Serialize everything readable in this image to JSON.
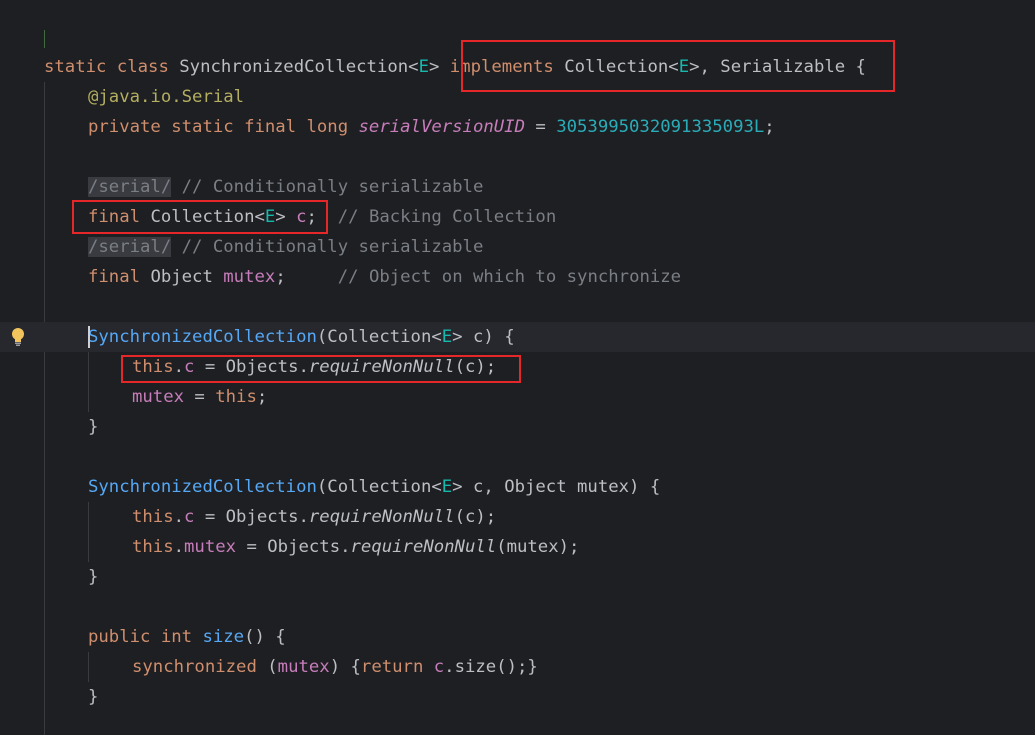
{
  "code_lines": [
    {
      "tokens": []
    },
    {
      "tokens": [
        {
          "t": "static class ",
          "k": "kw"
        },
        {
          "t": "SynchronizedCollection<",
          "k": "txt"
        },
        {
          "t": "E",
          "k": "tp"
        },
        {
          "t": "> ",
          "k": "txt"
        },
        {
          "t": "implements ",
          "k": "kw"
        },
        {
          "t": "Collection<",
          "k": "txt"
        },
        {
          "t": "E",
          "k": "tp"
        },
        {
          "t": ">, Serializable {",
          "k": "txt"
        }
      ]
    },
    {
      "tokens": [
        {
          "t": "@java.io.",
          "k": "ann"
        },
        {
          "t": "Serial",
          "k": "ann"
        }
      ]
    },
    {
      "tokens": [
        {
          "t": "private static final long ",
          "k": "kw"
        },
        {
          "t": "serialVersionUID",
          "k": "fldi"
        },
        {
          "t": " = ",
          "k": "txt"
        },
        {
          "t": "3053995032091335093L",
          "k": "num"
        },
        {
          "t": ";",
          "k": "txt"
        }
      ]
    },
    {
      "tokens": []
    },
    {
      "tokens": [
        {
          "t": "/serial/",
          "k": "tag"
        },
        {
          "t": " // Conditionally serializable",
          "k": "cmt"
        }
      ]
    },
    {
      "tokens": [
        {
          "t": "final ",
          "k": "kw"
        },
        {
          "t": "Collection<",
          "k": "txt"
        },
        {
          "t": "E",
          "k": "tp"
        },
        {
          "t": "> ",
          "k": "txt"
        },
        {
          "t": "c",
          "k": "fld"
        },
        {
          "t": ";  ",
          "k": "txt"
        },
        {
          "t": "// Backing Collection",
          "k": "cmt"
        }
      ]
    },
    {
      "tokens": [
        {
          "t": "/serial/",
          "k": "tag"
        },
        {
          "t": " // Conditionally serializable",
          "k": "cmt"
        }
      ]
    },
    {
      "tokens": [
        {
          "t": "final ",
          "k": "kw"
        },
        {
          "t": "Object ",
          "k": "txt"
        },
        {
          "t": "mutex",
          "k": "fld"
        },
        {
          "t": ";     ",
          "k": "txt"
        },
        {
          "t": "// Object on which to synchronize",
          "k": "cmt"
        }
      ]
    },
    {
      "tokens": []
    },
    {
      "tokens": [
        {
          "t": "SynchronizedCollection",
          "k": "fn"
        },
        {
          "t": "(Collection<",
          "k": "txt"
        },
        {
          "t": "E",
          "k": "tp"
        },
        {
          "t": "> c) {",
          "k": "txt"
        }
      ]
    },
    {
      "tokens": [
        {
          "t": "this",
          "k": "kw"
        },
        {
          "t": ".",
          "k": "txt"
        },
        {
          "t": "c",
          "k": "fld"
        },
        {
          "t": " = Objects.",
          "k": "txt"
        },
        {
          "t": "requireNonNull",
          "k": "it"
        },
        {
          "t": "(c);",
          "k": "txt"
        }
      ]
    },
    {
      "tokens": [
        {
          "t": "mutex",
          "k": "fld"
        },
        {
          "t": " = ",
          "k": "txt"
        },
        {
          "t": "this",
          "k": "kw"
        },
        {
          "t": ";",
          "k": "txt"
        }
      ]
    },
    {
      "tokens": [
        {
          "t": "}",
          "k": "txt"
        }
      ]
    },
    {
      "tokens": []
    },
    {
      "tokens": [
        {
          "t": "SynchronizedCollection",
          "k": "fn"
        },
        {
          "t": "(Collection<",
          "k": "txt"
        },
        {
          "t": "E",
          "k": "tp"
        },
        {
          "t": "> c, Object mutex) {",
          "k": "txt"
        }
      ]
    },
    {
      "tokens": [
        {
          "t": "this",
          "k": "kw"
        },
        {
          "t": ".",
          "k": "txt"
        },
        {
          "t": "c",
          "k": "fld"
        },
        {
          "t": " = Objects.",
          "k": "txt"
        },
        {
          "t": "requireNonNull",
          "k": "it"
        },
        {
          "t": "(c);",
          "k": "txt"
        }
      ]
    },
    {
      "tokens": [
        {
          "t": "this",
          "k": "kw"
        },
        {
          "t": ".",
          "k": "txt"
        },
        {
          "t": "mutex",
          "k": "fld"
        },
        {
          "t": " = Objects.",
          "k": "txt"
        },
        {
          "t": "requireNonNull",
          "k": "it"
        },
        {
          "t": "(mutex);",
          "k": "txt"
        }
      ]
    },
    {
      "tokens": [
        {
          "t": "}",
          "k": "txt"
        }
      ]
    },
    {
      "tokens": []
    },
    {
      "tokens": [
        {
          "t": "public int ",
          "k": "kw"
        },
        {
          "t": "size",
          "k": "fn"
        },
        {
          "t": "() {",
          "k": "txt"
        }
      ]
    },
    {
      "tokens": [
        {
          "t": "synchronized ",
          "k": "kw"
        },
        {
          "t": "(",
          "k": "txt"
        },
        {
          "t": "mutex",
          "k": "fld"
        },
        {
          "t": ") {",
          "k": "txt"
        },
        {
          "t": "return ",
          "k": "kw"
        },
        {
          "t": "c",
          "k": "fld"
        },
        {
          "t": ".size();}",
          "k": "txt"
        }
      ]
    },
    {
      "tokens": [
        {
          "t": "}",
          "k": "txt"
        }
      ]
    }
  ],
  "gutter": {
    "intention_icon": "lightbulb-icon"
  },
  "colors": {
    "background": "#1e1f22",
    "current_line": "#26282e",
    "keyword": "#cf8e6d",
    "type_param": "#16baac",
    "function": "#56a8f5",
    "field": "#c77dbb",
    "number": "#2aacb8",
    "comment": "#7a7e85",
    "annotation": "#b3ae60",
    "highlight_box": "#e5272a"
  }
}
